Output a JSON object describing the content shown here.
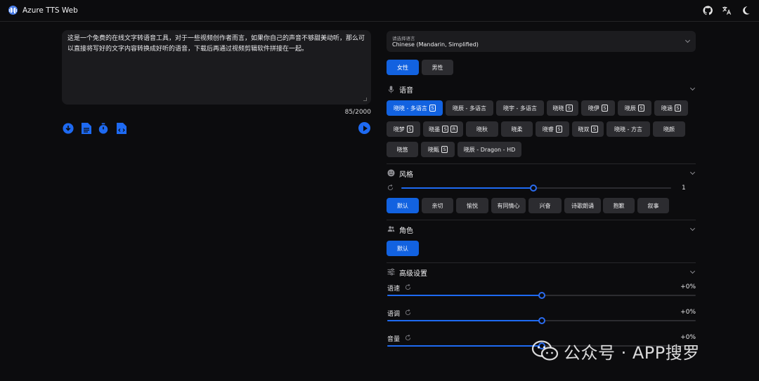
{
  "app": {
    "title": "Azure TTS Web"
  },
  "header": {
    "icons": [
      "github-icon",
      "translate-icon",
      "moon-icon"
    ]
  },
  "editor": {
    "text": "这是一个免费的在线文字转语音工具，对于一些视频创作者而言，如果你自己的声音不够甜美动听，那么可以直接将写好的文字内容转换成好听的语音，下载后再通过视频剪辑软件拼接在一起。",
    "counter": "85/2000",
    "tools": [
      "download-icon",
      "document-icon",
      "timer-icon",
      "code-file-icon"
    ],
    "play": "play-icon"
  },
  "language": {
    "caption": "请选择语言",
    "value": "Chinese (Mandarin, Simplified)"
  },
  "gender": {
    "options": [
      "女性",
      "男性"
    ],
    "selected": 0
  },
  "voice": {
    "title": "语音",
    "voices": [
      {
        "name": "晓晓 - 多语言",
        "badges": [
          "S"
        ],
        "active": true
      },
      {
        "name": "晓辰 - 多语言",
        "badges": []
      },
      {
        "name": "晓宇 - 多语言",
        "badges": []
      },
      {
        "name": "晓晓",
        "badges": [
          "S"
        ]
      },
      {
        "name": "晓伊",
        "badges": [
          "S"
        ]
      },
      {
        "name": "晓辰",
        "badges": [
          "S"
        ]
      },
      {
        "name": "晓涵",
        "badges": [
          "S"
        ]
      },
      {
        "name": "晓梦",
        "badges": [
          "S"
        ]
      },
      {
        "name": "晓墨",
        "badges": [
          "S",
          "R"
        ]
      },
      {
        "name": "晓秋",
        "badges": []
      },
      {
        "name": "晓柔",
        "badges": []
      },
      {
        "name": "晓睿",
        "badges": [
          "S"
        ]
      },
      {
        "name": "晓双",
        "badges": [
          "S"
        ]
      },
      {
        "name": "晓晓 - 方言",
        "badges": []
      },
      {
        "name": "晓颜",
        "badges": []
      },
      {
        "name": "晓悠",
        "badges": []
      },
      {
        "name": "晓甄",
        "badges": [
          "S"
        ]
      },
      {
        "name": "晓辰 - Dragon - HD",
        "badges": []
      }
    ]
  },
  "style": {
    "title": "风格",
    "degree_value": "1",
    "degree_fraction": 0.49,
    "options": [
      "默认",
      "亲切",
      "愉悦",
      "有同情心",
      "兴奋",
      "诗歌朗诵",
      "抱歉",
      "叙事"
    ],
    "selected": 0
  },
  "role": {
    "title": "角色",
    "options": [
      "默认"
    ],
    "selected": 0
  },
  "advanced": {
    "title": "高级设置",
    "sliders": [
      {
        "label": "语速",
        "value": "+0%",
        "fraction": 0.5
      },
      {
        "label": "语调",
        "value": "+0%",
        "fraction": 0.5
      },
      {
        "label": "音量",
        "value": "+0%",
        "fraction": 0.5
      }
    ]
  },
  "watermark": {
    "text": "公众号 · APP搜罗"
  },
  "colors": {
    "accent": "#1262e0",
    "background": "#0c0c0e",
    "panel": "#1c1c1f",
    "chip": "#2c2c30"
  }
}
